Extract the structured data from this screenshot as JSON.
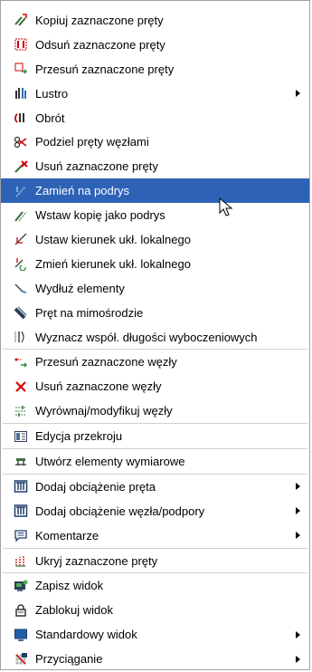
{
  "menu": {
    "items": [
      {
        "label": "Kopiuj zaznaczone pręty",
        "icon": "copy-bars-icon"
      },
      {
        "label": "Odsuń zaznaczone pręty",
        "icon": "offset-bars-icon"
      },
      {
        "label": "Przesuń zaznaczone pręty",
        "icon": "move-bars-icon"
      },
      {
        "label": "Lustro",
        "icon": "mirror-icon",
        "submenu": true
      },
      {
        "label": "Obrót",
        "icon": "rotate-icon"
      },
      {
        "label": "Podziel pręty węzłami",
        "icon": "split-bars-icon"
      },
      {
        "label": "Usuń zaznaczone pręty",
        "icon": "delete-bars-icon"
      },
      {
        "label": "Zamień na podrys",
        "icon": "convert-underlay-icon",
        "highlighted": true
      },
      {
        "label": "Wstaw kopię jako podrys",
        "icon": "insert-copy-underlay-icon"
      },
      {
        "label": "Ustaw kierunek ukł. lokalnego",
        "icon": "set-local-axis-icon"
      },
      {
        "label": "Zmień kierunek ukł. lokalnego",
        "icon": "change-local-axis-icon"
      },
      {
        "label": "Wydłuż elementy",
        "icon": "extend-elements-icon"
      },
      {
        "label": "Pręt na mimośrodzie",
        "icon": "eccentric-bar-icon"
      },
      {
        "label": "Wyznacz współ. długości wyboczeniowych",
        "icon": "buckling-length-icon"
      },
      {
        "label": "Przesuń zaznaczone węzły",
        "icon": "move-nodes-icon"
      },
      {
        "label": "Usuń zaznaczone węzły",
        "icon": "delete-nodes-icon"
      },
      {
        "label": "Wyrównaj/modyfikuj węzły",
        "icon": "align-nodes-icon"
      },
      {
        "label": "Edycja przekroju",
        "icon": "section-edit-icon"
      },
      {
        "label": "Utwórz elementy wymiarowe",
        "icon": "dimension-elements-icon"
      },
      {
        "label": "Dodaj obciążenie pręta",
        "icon": "bar-load-icon",
        "submenu": true
      },
      {
        "label": "Dodaj obciążenie węzła/podpory",
        "icon": "node-load-icon",
        "submenu": true
      },
      {
        "label": "Komentarze",
        "icon": "comments-icon",
        "submenu": true
      },
      {
        "label": "Ukryj zaznaczone pręty",
        "icon": "hide-bars-icon"
      },
      {
        "label": "Zapisz widok",
        "icon": "save-view-icon"
      },
      {
        "label": "Zablokuj widok",
        "icon": "lock-view-icon"
      },
      {
        "label": "Standardowy widok",
        "icon": "standard-view-icon",
        "submenu": true
      },
      {
        "label": "Przyciąganie",
        "icon": "snapping-icon",
        "submenu": true
      }
    ]
  }
}
